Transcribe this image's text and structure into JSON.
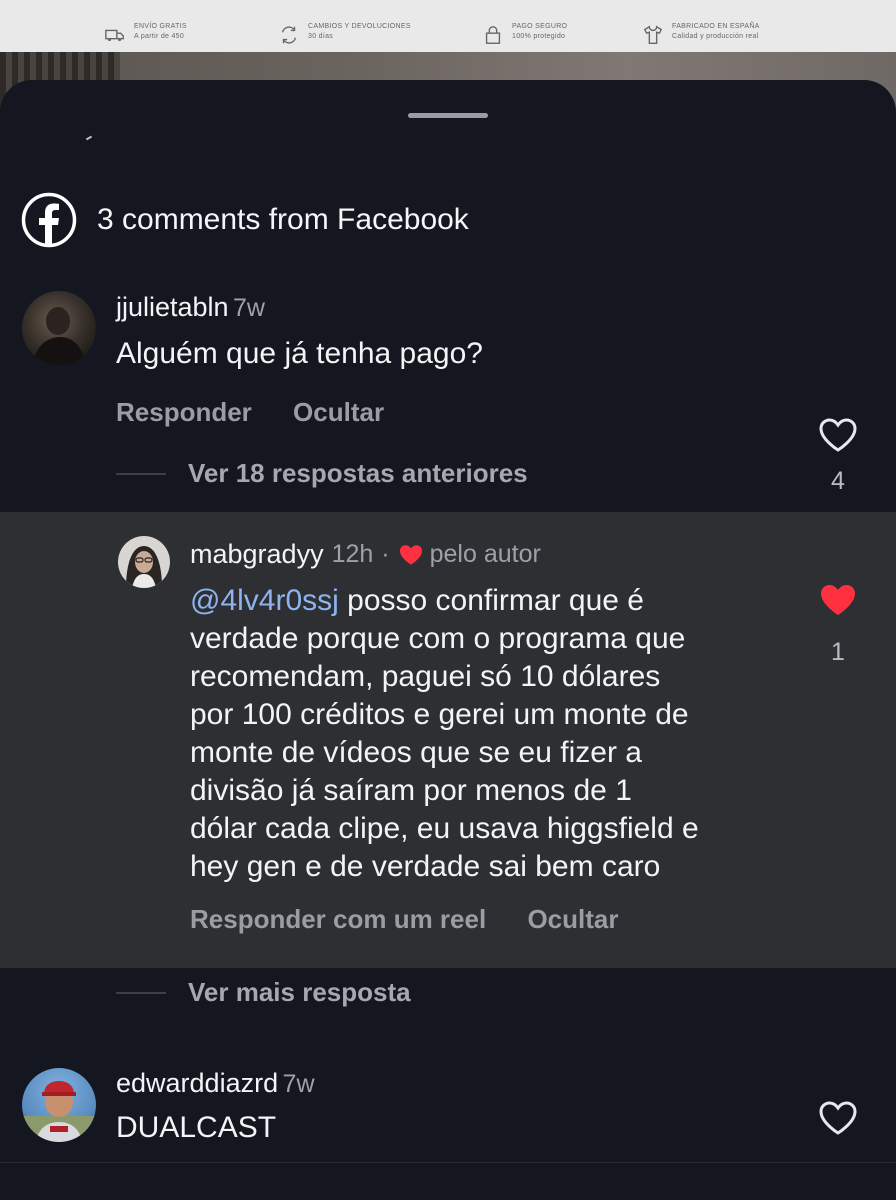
{
  "background": {
    "features": [
      {
        "title": "ENVÍO GRATIS",
        "sub": "A partir de 450",
        "icon": "truck-icon"
      },
      {
        "title": "CAMBIOS Y DEVOLUCIONES",
        "sub": "30 días",
        "icon": "return-arrows-icon"
      },
      {
        "title": "PAGO SEGURO",
        "sub": "100% protegido",
        "icon": "lock-icon"
      },
      {
        "title": "FABRICADO EN ESPAÑA",
        "sub": "Calidad y producción real",
        "icon": "tshirt-icon"
      }
    ]
  },
  "header": {
    "title": "3 comments from Facebook",
    "icon": "facebook-icon"
  },
  "comments": [
    {
      "username": "jjulietabln",
      "time": "7w",
      "text": "Alguém que já tenha pago?",
      "actions": [
        "Responder",
        "Ocultar"
      ],
      "likes": "4",
      "liked": false
    },
    {
      "username": "mabgradyy",
      "time": "12h",
      "separator": "·",
      "author_badge": "pelo autor",
      "mention": "@4lv4r0ssj",
      "text_lines": [
        " posso confirmar que é",
        "verdade porque com o programa que",
        "recomendam, paguei só 10 dólares",
        "por 100 créditos e gerei um monte de",
        "monte de vídeos que se eu fizer a",
        "divisão já saíram por menos de 1",
        "dólar cada clipe, eu usava higgsfield e",
        "hey gen e de verdade sai bem caro"
      ],
      "actions": [
        "Responder com um reel",
        "Ocultar"
      ],
      "likes": "1",
      "liked": true
    },
    {
      "username": "edwarddiazrd",
      "time": "7w",
      "text": "DUALCAST",
      "liked": false
    }
  ],
  "replies": {
    "view_previous": "Ver 18 respostas anteriores",
    "view_more": "Ver mais resposta"
  },
  "colors": {
    "heart_red": "#ff3040",
    "mention_blue": "#8fb3ee",
    "sheet_bg": "#141720"
  }
}
